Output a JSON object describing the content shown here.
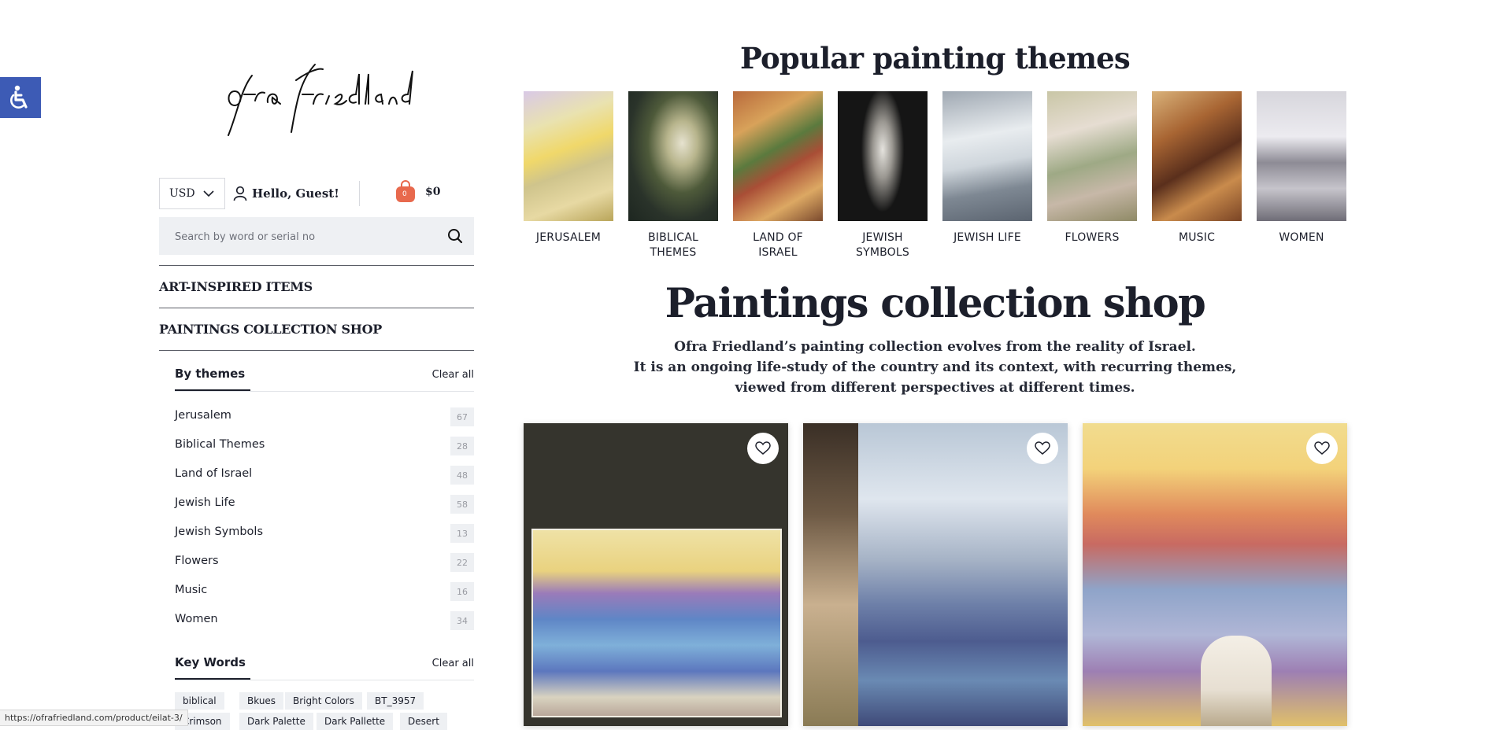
{
  "colors": {
    "accent_blue": "#3d5bb5",
    "cart_orange": "#e8694d",
    "text_dark": "#1c1f2b"
  },
  "logo": {
    "text": "ofra friedland"
  },
  "header": {
    "currency": "USD",
    "greeting": "Hello, Guest!",
    "cart_count": "0",
    "cart_total": "$0",
    "search_placeholder": "Search by word or serial no"
  },
  "nav": [
    {
      "label": "ART-INSPIRED ITEMS"
    },
    {
      "label": "PAINTINGS COLLECTION SHOP"
    }
  ],
  "filters": {
    "themes_title": "By themes",
    "clear_label": "Clear all",
    "themes": [
      {
        "label": "Jerusalem",
        "count": "67"
      },
      {
        "label": "Biblical Themes",
        "count": "28"
      },
      {
        "label": "Land of Israel",
        "count": "48"
      },
      {
        "label": "Jewish Life",
        "count": "58"
      },
      {
        "label": "Jewish Symbols",
        "count": "13"
      },
      {
        "label": "Flowers",
        "count": "22"
      },
      {
        "label": "Music",
        "count": "16"
      },
      {
        "label": "Women",
        "count": "34"
      }
    ],
    "keywords_title": "Key Words",
    "keywords": [
      "biblical",
      "Bkues",
      "Bright Colors",
      "BT_3957",
      "Crimson",
      "Dark Palette",
      "Dark Pallette",
      "Desert"
    ]
  },
  "popular": {
    "title": "Popular painting themes",
    "themes": [
      {
        "label": "JERUSALEM"
      },
      {
        "label": "BIBLICAL THEMES"
      },
      {
        "label": "LAND OF ISRAEL"
      },
      {
        "label": "JEWISH SYMBOLS"
      },
      {
        "label": "JEWISH LIFE"
      },
      {
        "label": "FLOWERS"
      },
      {
        "label": "MUSIC"
      },
      {
        "label": "WOMEN"
      }
    ]
  },
  "shop": {
    "title": "Paintings collection shop",
    "desc_lines": [
      "Ofra Friedland’s painting collection evolves from the reality of Israel.",
      "It is an ongoing life-study of the country and its context, with recurring themes,",
      "viewed from different perspectives at different times."
    ]
  },
  "status_url": "https://ofrafriedland.com/product/eilat-3/"
}
